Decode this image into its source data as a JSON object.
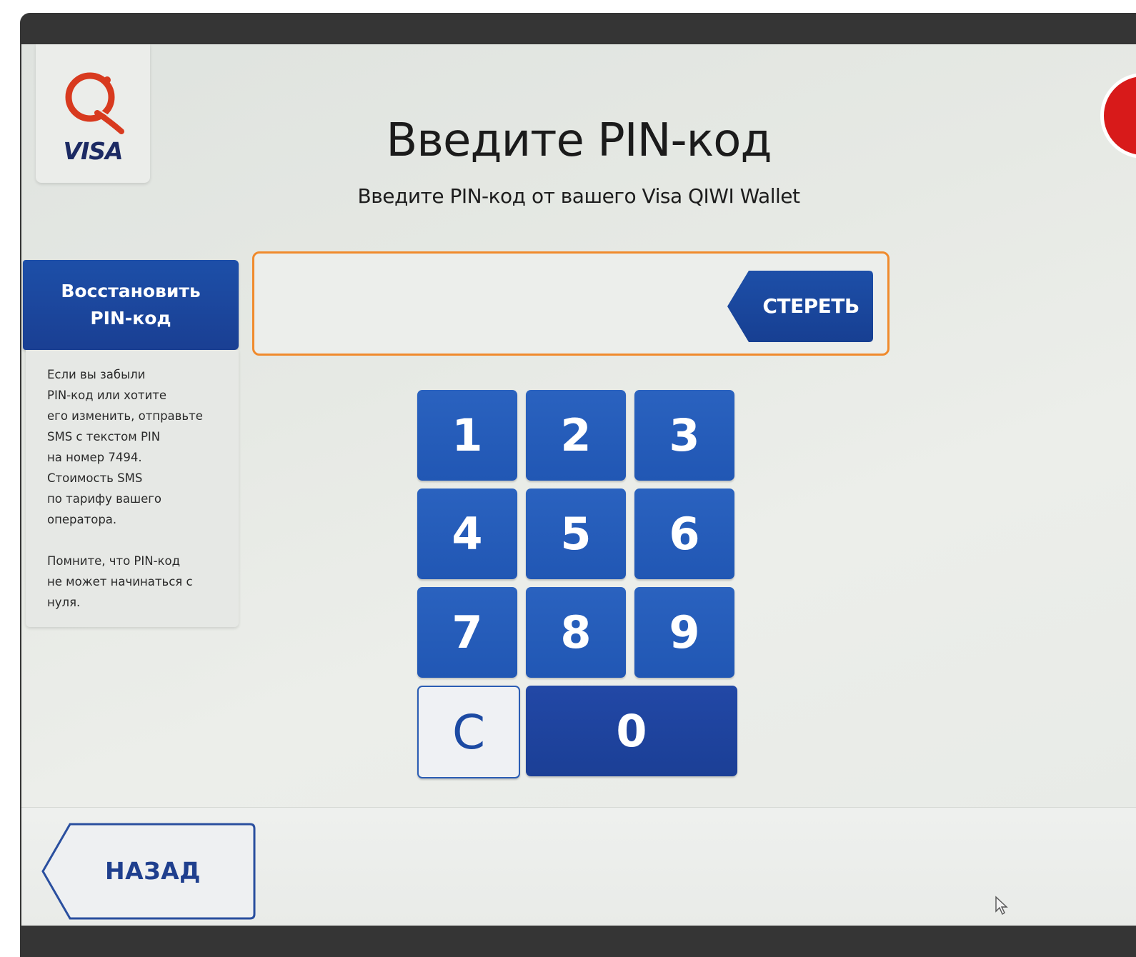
{
  "brand": {
    "logo_text": "VISA",
    "colors": {
      "primary_blue": "#2157b4",
      "dark_blue": "#1a3f93",
      "accent_orange": "#f08a2c",
      "logo_red": "#d83a1f"
    }
  },
  "header": {
    "title": "Введите PIN-код",
    "subtitle": "Введите PIN-код от вашего Visa QIWI Wallet"
  },
  "help": {
    "restore_button_line1": "Восстановить",
    "restore_button_line2": "PIN-код",
    "text": "Если вы забыли\nPIN-код или хотите\nего изменить, отправьте\nSMS с текстом PIN\nна номер 7494.\nСтоимость SMS\nпо тарифу вашего\nоператора.\n\nПомните, что PIN-код\nне может начинаться с\nнуля."
  },
  "pin_input": {
    "value": "",
    "erase_label": "СТЕРЕТЬ"
  },
  "keypad": {
    "keys": [
      "1",
      "2",
      "3",
      "4",
      "5",
      "6",
      "7",
      "8",
      "9"
    ],
    "clear_label": "C",
    "zero_label": "0"
  },
  "footer": {
    "back_label": "НАЗАД"
  },
  "icons": {
    "logo": "qiwi-q-logo-icon",
    "cursor": "mouse-pointer-icon",
    "badge": "red-circle-badge-icon"
  }
}
